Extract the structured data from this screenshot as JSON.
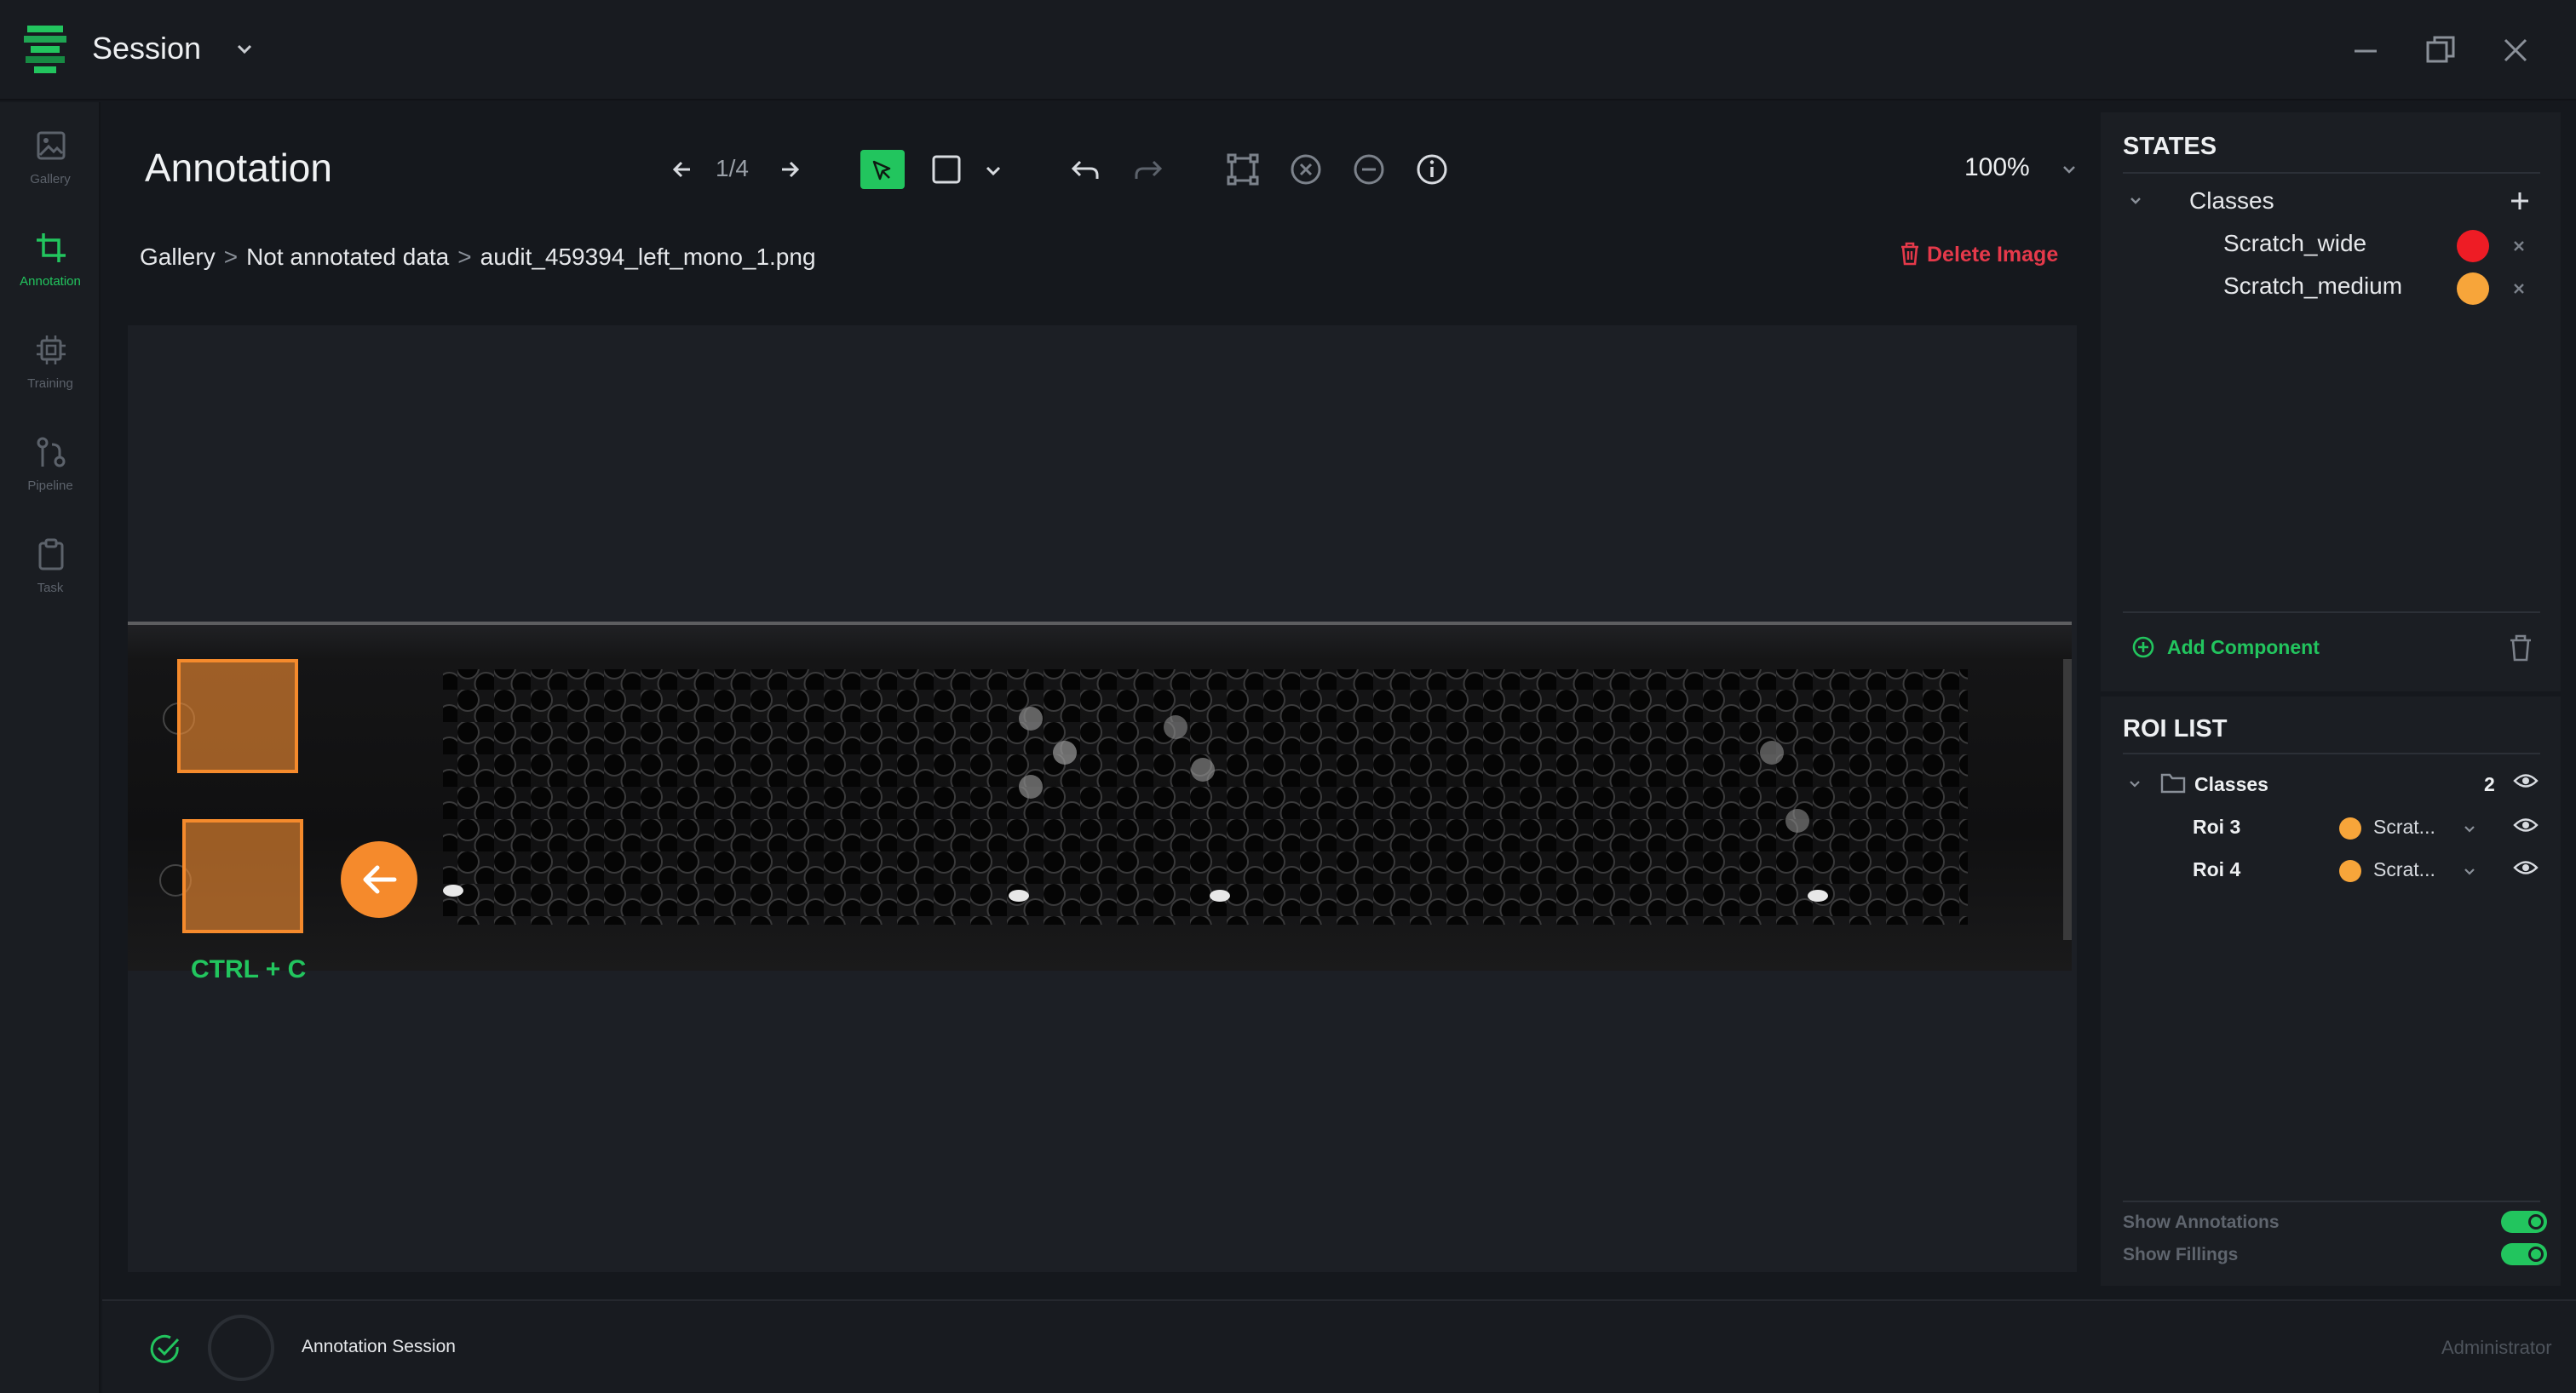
{
  "app": {
    "title": "Session",
    "accent": "#22c55e",
    "logo_icon": "stacked-layers-logo"
  },
  "window_controls": [
    "minimize-icon",
    "restore-icon",
    "close-icon"
  ],
  "nav": [
    {
      "label": "Gallery",
      "icon": "image-icon",
      "active": false
    },
    {
      "label": "Annotation",
      "icon": "crop-icon",
      "active": true
    },
    {
      "label": "Training",
      "icon": "chip-icon",
      "active": false
    },
    {
      "label": "Pipeline",
      "icon": "git-branch-icon",
      "active": false
    },
    {
      "label": "Task",
      "icon": "clipboard-icon",
      "active": false
    }
  ],
  "header": {
    "title": "Annotation",
    "pager": "1/4",
    "zoom": "100%"
  },
  "breadcrumb": {
    "items": [
      "Gallery",
      "Not annotated data",
      "audit_459394_left_mono_1.png"
    ],
    "separator": ">"
  },
  "delete_image": {
    "label": "Delete Image",
    "color": "#e5394a"
  },
  "canvas": {
    "hint_label": "CTRL + C",
    "roi_color": "#f58a2c"
  },
  "states": {
    "title": "STATES",
    "group_label": "Classes",
    "classes": [
      {
        "name": "Scratch_wide",
        "color": "#ee1c25"
      },
      {
        "name": "Scratch_medium",
        "color": "#f7a53a"
      }
    ],
    "add_component_label": "Add Component"
  },
  "roi_list": {
    "title": "ROI LIST",
    "group_label": "Classes",
    "count": "2",
    "rois": [
      {
        "name": "Roi 3",
        "class_label": "Scrat...",
        "color": "#f7a53a"
      },
      {
        "name": "Roi 4",
        "class_label": "Scrat...",
        "color": "#f7a53a"
      }
    ]
  },
  "toggles": [
    {
      "label": "Show Annotations",
      "on": true
    },
    {
      "label": "Show Fillings",
      "on": true
    }
  ],
  "status": {
    "session_label": "Annotation Session",
    "user": "Administrator"
  }
}
